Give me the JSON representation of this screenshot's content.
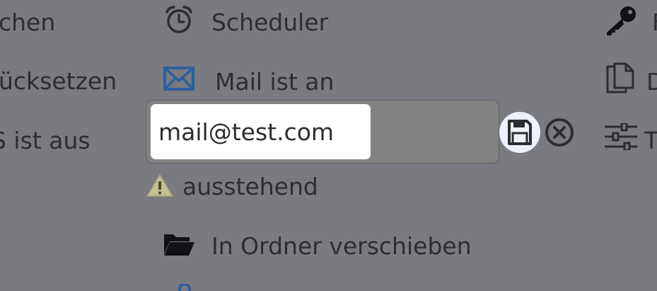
{
  "left_column": {
    "item1": "chen",
    "item2": "ücksetzen",
    "item3": "S ist aus"
  },
  "middle_column": {
    "scheduler_label": "Scheduler",
    "mail_label": "Mail ist an",
    "email_input_value": "mail@test.com",
    "status_label": "ausstehend",
    "move_folder_label": "In Ordner verschieben"
  },
  "right_column": {
    "item1": "F",
    "item2": "D",
    "item3": "T"
  },
  "icons": {
    "clock": "alarm-clock-icon",
    "mail": "envelope-icon",
    "warning": "warning-triangle-icon",
    "folder": "folder-open-icon",
    "key": "key-icon",
    "document": "document-copy-icon",
    "settings": "sliders-icon",
    "save": "floppy-disk-icon",
    "cancel": "close-circle-icon"
  },
  "colors": {
    "background": "#7a7b80",
    "mail_icon": "#2b5f9e",
    "warning_icon": "#6e6e4a",
    "save_button_bg": "#eef0fb"
  }
}
